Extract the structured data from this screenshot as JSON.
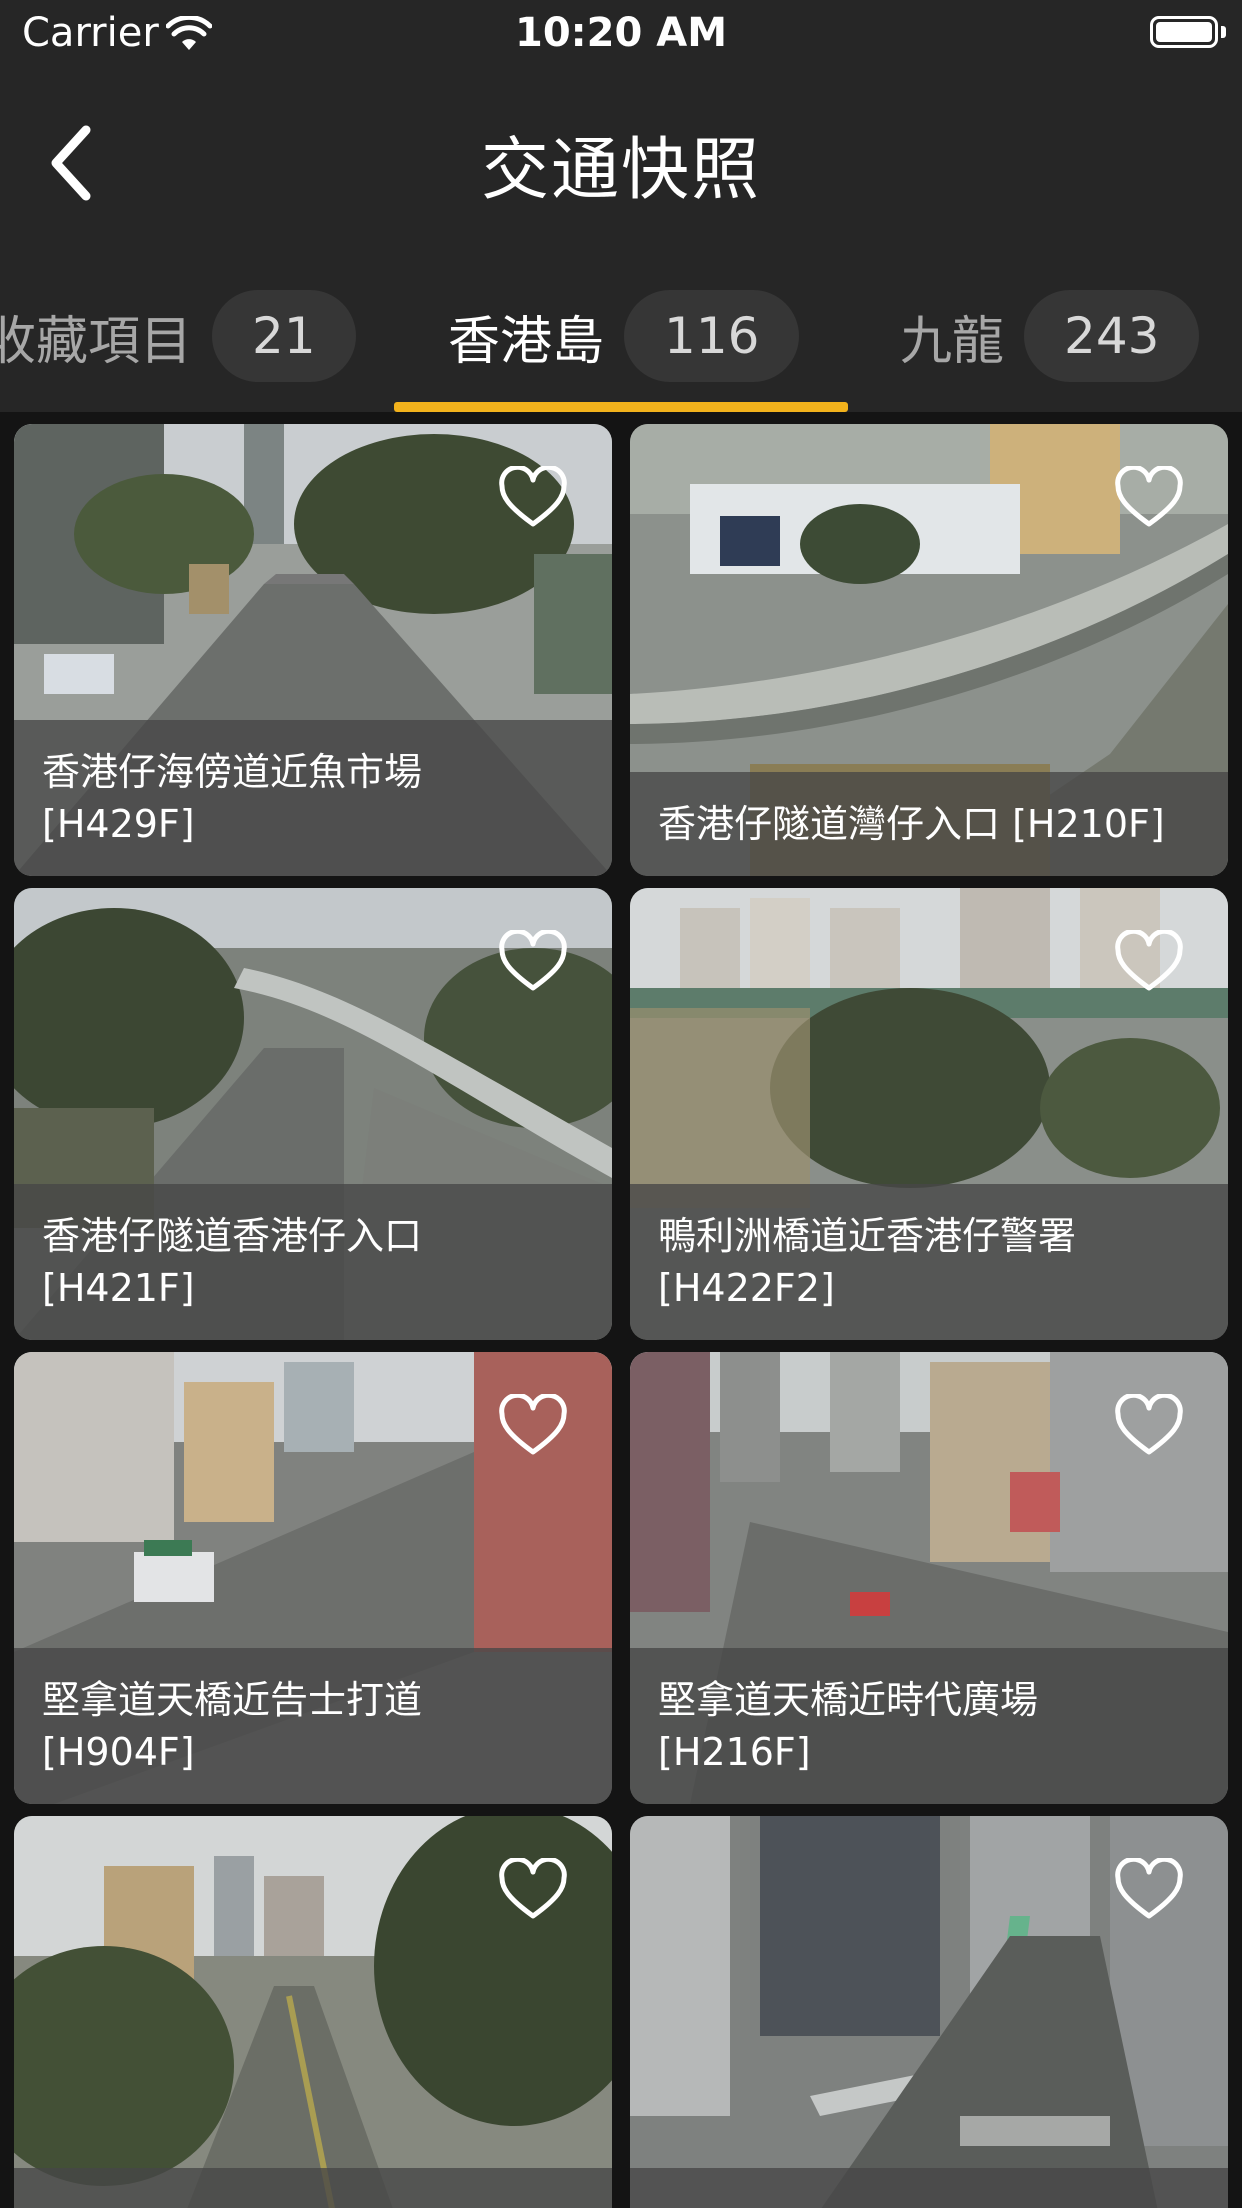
{
  "status": {
    "carrier": "Carrier",
    "time": "10:20 AM",
    "icons": [
      "wifi-icon",
      "battery-icon"
    ]
  },
  "nav": {
    "title": "交通快照",
    "back_icon": "chevron-left-icon"
  },
  "tabs": [
    {
      "label": "收藏項目",
      "count": "21"
    },
    {
      "label": "香港島",
      "count": "116"
    },
    {
      "label": "九龍",
      "count": "243"
    }
  ],
  "colors": {
    "background": "#262626",
    "accent": "#f2b21c",
    "grid_bg": "#141414"
  },
  "cameras": [
    {
      "title": "香港仔海傍道近魚市場",
      "code": "[H429F]",
      "favorite_icon": "heart-outline-icon"
    },
    {
      "title": "香港仔隧道灣仔入口 [H210F]",
      "code": "",
      "favorite_icon": "heart-outline-icon"
    },
    {
      "title": "香港仔隧道香港仔入口",
      "code": "[H421F]",
      "favorite_icon": "heart-outline-icon"
    },
    {
      "title": "鴨利洲橋道近香港仔警署",
      "code": "[H422F2]",
      "favorite_icon": "heart-outline-icon"
    },
    {
      "title": "堅拿道天橋近告士打道",
      "code": "[H904F]",
      "favorite_icon": "heart-outline-icon"
    },
    {
      "title": "堅拿道天橋近時代廣場",
      "code": "[H216F]",
      "favorite_icon": "heart-outline-icon"
    },
    {
      "title": "",
      "code": "",
      "favorite_icon": "heart-outline-icon"
    },
    {
      "title": "",
      "code": "",
      "favorite_icon": "heart-outline-icon"
    }
  ]
}
